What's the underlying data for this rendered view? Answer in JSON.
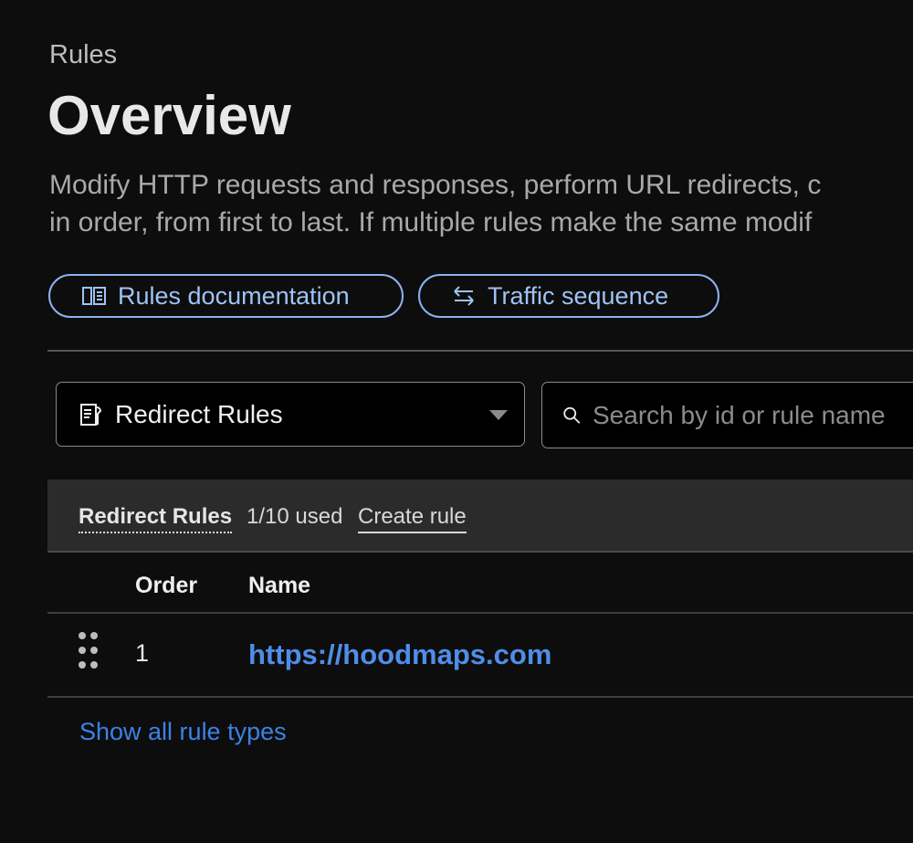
{
  "header": {
    "breadcrumb": "Rules",
    "title": "Overview",
    "description_line1": "Modify HTTP requests and responses, perform URL redirects, c",
    "description_line2": "in order, from first to last. If multiple rules make the same modif"
  },
  "actions": {
    "docs_label": "Rules documentation",
    "traffic_label": "Traffic sequence"
  },
  "filters": {
    "rule_type_selected": "Redirect Rules",
    "search_placeholder": "Search by id or rule name"
  },
  "section": {
    "title": "Redirect Rules",
    "usage": "1/10 used",
    "create_label": "Create rule"
  },
  "table": {
    "columns": [
      "Order",
      "Name"
    ],
    "rows": [
      {
        "order": "1",
        "name": "https://hoodmaps.com"
      }
    ]
  },
  "footer": {
    "show_all_label": "Show all rule types"
  },
  "colors": {
    "accent": "#4f8ee8",
    "pill_border": "#8ab4f0",
    "background": "#0d0d0d"
  }
}
